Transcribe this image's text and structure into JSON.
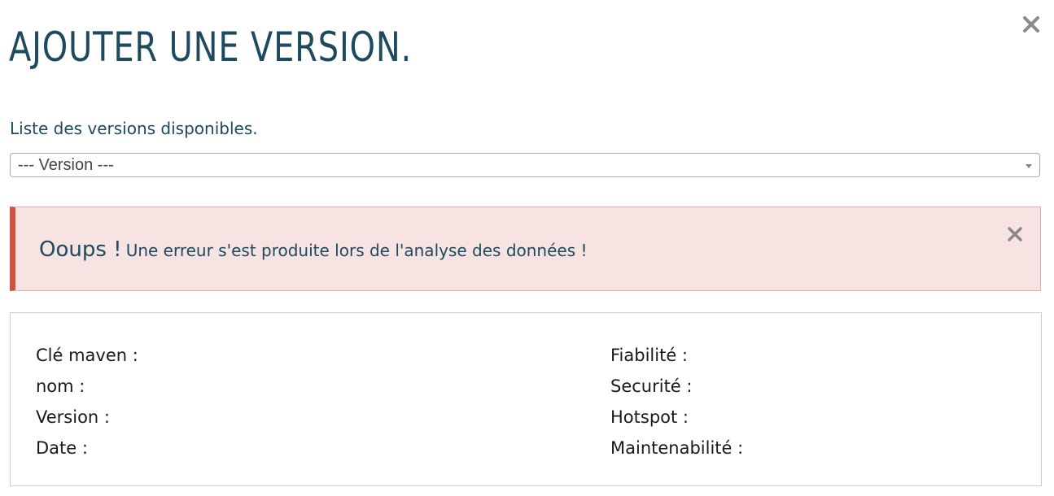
{
  "modal": {
    "title": "AJOUTER UNE VERSION.",
    "close_icon": "close-icon"
  },
  "versions": {
    "label": "Liste des versions disponibles.",
    "selected": "--- Version ---",
    "arrow_icon": "caret-down-icon"
  },
  "alert": {
    "heading": "Ooups !",
    "message": "Une erreur s'est produite lors de l'analyse des données !",
    "close_icon": "close-icon",
    "accent_color": "#cf5440",
    "background_color": "#f6e3e2"
  },
  "details": {
    "left": [
      {
        "label": "Clé maven :"
      },
      {
        "label": "nom :"
      },
      {
        "label": "Version :"
      },
      {
        "label": "Date :"
      }
    ],
    "right": [
      {
        "label": "Fiabilité :"
      },
      {
        "label": "Securité :"
      },
      {
        "label": "Hotspot :"
      },
      {
        "label": "Maintenabilité :"
      }
    ]
  },
  "colors": {
    "title": "#1d4a5e",
    "close": "#8a8a8a"
  }
}
